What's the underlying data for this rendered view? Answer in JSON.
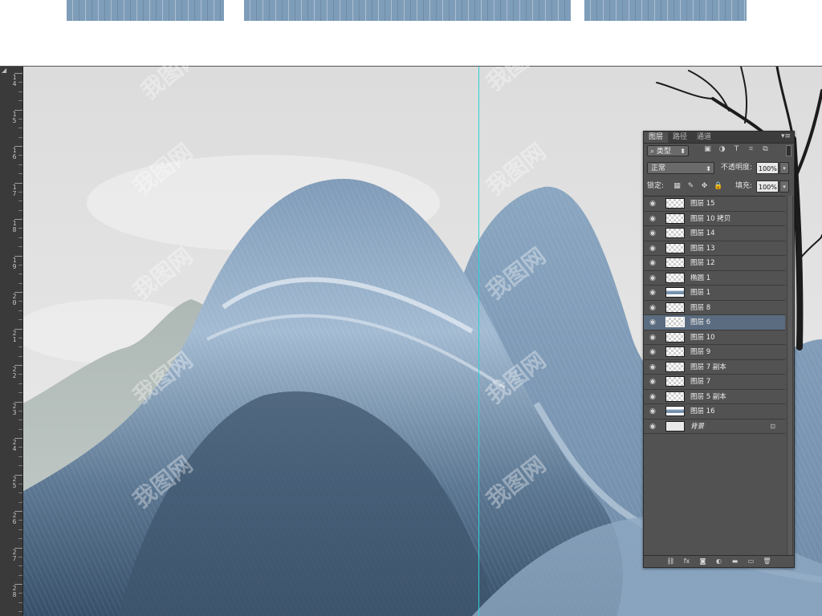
{
  "panel": {
    "tabs": [
      "图层",
      "路径",
      "通道"
    ],
    "active_tab": "图层",
    "menu_glyph": "▾≡",
    "filter": {
      "kind_label": "类型",
      "search_glyph": "⌕",
      "icon_glyphs": [
        "▣",
        "◑",
        "T",
        "⌗",
        "⧉"
      ]
    },
    "blend_mode": "正常",
    "opacity_label": "不透明度:",
    "opacity_value": "100%",
    "lock_label": "锁定:",
    "lock_glyphs": [
      "▦",
      "✎",
      "✥",
      "🔒"
    ],
    "fill_label": "填充:",
    "fill_value": "100%",
    "dropdown_glyph": "▾",
    "visibility_glyph": "◉",
    "layers": [
      {
        "name": "图层 15",
        "thumb": "transparent"
      },
      {
        "name": "图层 10 拷贝",
        "thumb": "transparent"
      },
      {
        "name": "图层 14",
        "thumb": "transparent"
      },
      {
        "name": "图层 13",
        "thumb": "transparent"
      },
      {
        "name": "图层 12",
        "thumb": "transparent"
      },
      {
        "name": "椭圆 1",
        "thumb": "transparent"
      },
      {
        "name": "图层 1",
        "thumb": "waves"
      },
      {
        "name": "图层 8",
        "thumb": "transparent"
      },
      {
        "name": "图层 6",
        "thumb": "transparent",
        "selected": true
      },
      {
        "name": "图层 10",
        "thumb": "transparent"
      },
      {
        "name": "图层 9",
        "thumb": "transparent"
      },
      {
        "name": "图层 7 副本",
        "thumb": "transparent"
      },
      {
        "name": "图层 7",
        "thumb": "transparent"
      },
      {
        "name": "图层 5 副本",
        "thumb": "transparent"
      },
      {
        "name": "图层 16",
        "thumb": "waves"
      },
      {
        "name": "背景",
        "thumb": "bg",
        "locked": true,
        "italic": true
      }
    ],
    "footer_glyphs": [
      "⛓",
      "fx",
      "◙",
      "◐",
      "▬",
      "▭",
      "🗑"
    ]
  },
  "ruler": {
    "corner_glyph": "◢",
    "labels": [
      "14",
      "15",
      "16",
      "17",
      "18",
      "19",
      "20",
      "21",
      "22",
      "23",
      "24",
      "25",
      "26",
      "27",
      "28"
    ]
  },
  "watermark": {
    "text": "我图网"
  },
  "colors": {
    "wave_light": "#a9c0d6",
    "wave_mid": "#7b98b5",
    "wave_dark": "#3e5670",
    "sky": "#e3e3e3",
    "guide": "#2fd1d6",
    "panel_bg": "#525252",
    "selected_row": "#5b6c80"
  }
}
